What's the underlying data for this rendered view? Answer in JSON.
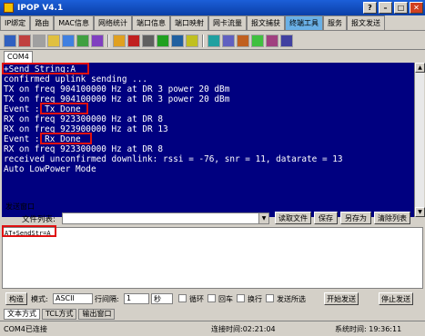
{
  "window": {
    "title": "IPOP V4.1"
  },
  "tabs": [
    {
      "label": "IP绑定"
    },
    {
      "label": "路由"
    },
    {
      "label": "MAC信息"
    },
    {
      "label": "网络统计"
    },
    {
      "label": "端口信息"
    },
    {
      "label": "端口映射"
    },
    {
      "label": "网卡流量"
    },
    {
      "label": "报文捕获"
    },
    {
      "label": "终端工具",
      "active": true
    },
    {
      "label": "服务"
    },
    {
      "label": "报文发送"
    }
  ],
  "port_tab": "COM4",
  "terminal": {
    "lines": [
      "+Send String:A",
      "confirmed uplink sending ...",
      "TX on freq 904100000 Hz at DR 3 power 20 dBm",
      "TX on freq 904100000 Hz at DR 3 power 20 dBm",
      "Event : Tx Done",
      "RX on freq 923300000 Hz at DR 8",
      "RX on freq 923900000 Hz at DR 13",
      "Event : Rx Done",
      "RX on freq 923300000 Hz at DR 8",
      "received unconfirmed downlink: rssi = -76, snr = 11, datarate = 13",
      "Auto LowPower Mode"
    ]
  },
  "send_window": {
    "legend": "发送窗口",
    "file_list_label": "文件列表:",
    "buttons": {
      "read": "读取文件",
      "save": "保存",
      "save_as": "另存为",
      "clear_list": "清除列表"
    },
    "send_text": "AT+SendStr=A"
  },
  "controls": {
    "construct": "构造",
    "mode_label": "模式:",
    "mode_value": "ASCII",
    "interval_label": "行间隔:",
    "interval_value": "1",
    "interval_unit": "秒",
    "loop": "循环",
    "cr": "回车",
    "lf": "换行",
    "send_selected": "发送所选",
    "start_send": "开始发送",
    "stop_send": "停止发送"
  },
  "bottom_tabs": [
    {
      "label": "文本方式",
      "active": true
    },
    {
      "label": "TCL方式"
    },
    {
      "label": "输出窗口"
    }
  ],
  "status": {
    "left": "COM4已连接",
    "connect_time": "连接时间:02:21:04",
    "system_time": "系统时间: 19:36:11"
  },
  "colors": {
    "terminal_bg": "#000080",
    "highlight": "#e01010",
    "active_tab": "#6ab0e6"
  }
}
